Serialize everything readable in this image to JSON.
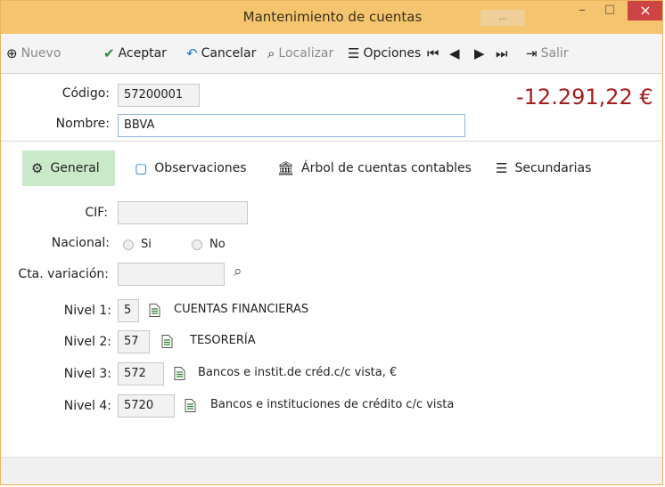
{
  "window": {
    "title": "Mantenimiento de cuentas",
    "title_chip": "...",
    "min_label": "–",
    "max_label": "□",
    "close_label": "×"
  },
  "toolbar": {
    "items": [
      {
        "label": "Nuevo",
        "icon": "plus-circle-icon",
        "enabled": false
      },
      {
        "label": "Aceptar",
        "icon": "check-icon",
        "enabled": true
      },
      {
        "label": "Cancelar",
        "icon": "undo-icon",
        "enabled": true
      },
      {
        "label": "Localizar",
        "icon": "search-icon",
        "enabled": false
      },
      {
        "label": "Opciones",
        "icon": "list-icon",
        "enabled": true
      },
      {
        "label": "",
        "icon": "first-icon",
        "enabled": false
      },
      {
        "label": "",
        "icon": "prev-icon",
        "enabled": false
      },
      {
        "label": "",
        "icon": "next-icon",
        "enabled": false
      },
      {
        "label": "",
        "icon": "last-icon",
        "enabled": false
      },
      {
        "label": "Salir",
        "icon": "exit-icon",
        "enabled": false
      }
    ]
  },
  "header": {
    "codigo_label": "Código:",
    "codigo_value": "57200001",
    "nombre_label": "Nombre:",
    "nombre_value": "BBVA",
    "amount": "-12.291,22 €"
  },
  "tabs": [
    {
      "label": "General",
      "icon": "gears-icon",
      "active": true
    },
    {
      "label": "Observaciones",
      "icon": "speech-bubble-icon",
      "active": false
    },
    {
      "label": "Árbol de cuentas contables",
      "icon": "bank-user-icon",
      "active": false
    },
    {
      "label": "Secundarias",
      "icon": "list-doc-icon",
      "active": false
    }
  ],
  "form": {
    "cif_label": "CIF:",
    "cif_value": "",
    "nacional_label": "Nacional:",
    "radio_si": "Si",
    "radio_no": "No",
    "cta_variacion_label": "Cta. variación:",
    "cta_variacion_value": ""
  },
  "levels": [
    {
      "label": "Nivel 1:",
      "code": "5",
      "text": "CUENTAS FINANCIERAS"
    },
    {
      "label": "Nivel 2:",
      "code": "57",
      "text": "TESORERÍA"
    },
    {
      "label": "Nivel 3:",
      "code": "572",
      "text": "Bancos e instit.de créd.c/c vista, €"
    },
    {
      "label": "Nivel 4:",
      "code": "5720",
      "text": "Bancos e instituciones de crédito c/c vista"
    }
  ],
  "colors": {
    "titlebar": "#f4c46f",
    "accent_active_tab": "#c9eac9",
    "amount": "#a11f1f",
    "close_button": "#c44"
  }
}
